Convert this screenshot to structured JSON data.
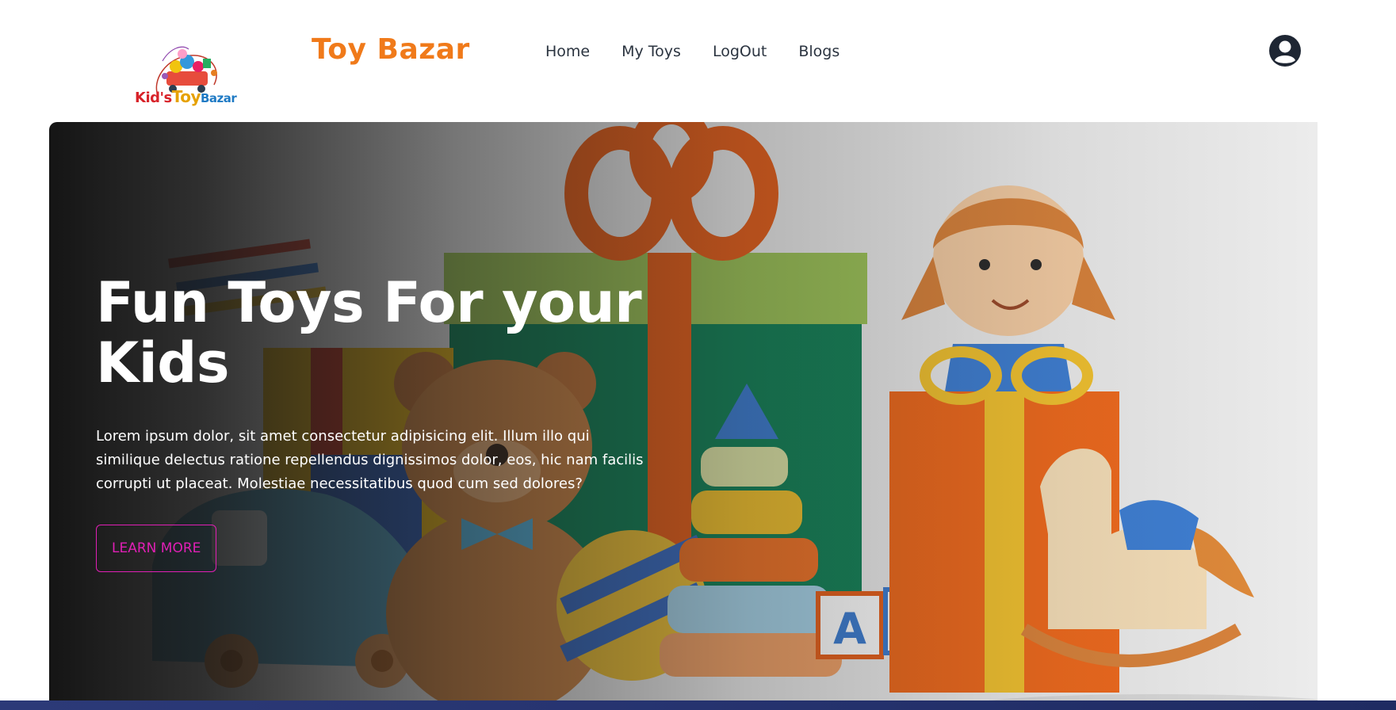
{
  "nav": {
    "logo": {
      "line1": "Kid's",
      "line2": "Toy",
      "line3": "Bazar"
    },
    "brand": "Toy Bazar",
    "links": [
      {
        "label": "Home"
      },
      {
        "label": "My Toys"
      },
      {
        "label": "LogOut"
      },
      {
        "label": "Blogs"
      }
    ],
    "account_icon": "user-circle-icon"
  },
  "hero": {
    "title": "Fun Toys For your Kids",
    "description": "Lorem ipsum dolor, sit amet consectetur adipisicing elit. Illum illo qui similique delectus ratione repellendus dignissimos dolor, eos, hic nam facilis corrupti ut placeat. Molestiae necessitatibus quod cum sed dolores?",
    "button_label": "LEARN MORE"
  },
  "colors": {
    "brand": "#f07a1a",
    "button": "#e01fb5",
    "nav_text": "#2b3440"
  }
}
